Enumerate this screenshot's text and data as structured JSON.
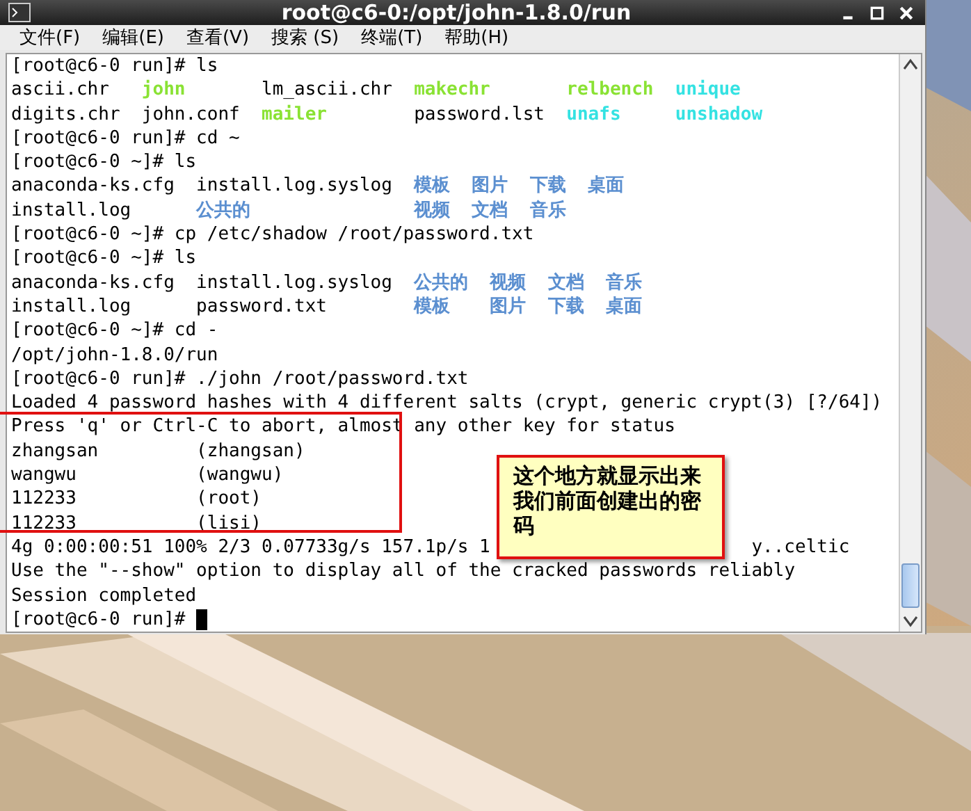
{
  "window": {
    "title": "root@c6-0:/opt/john-1.8.0/run"
  },
  "menu": [
    "文件(F)",
    "编辑(E)",
    "查看(V)",
    "搜索 (S)",
    "终端(T)",
    "帮助(H)"
  ],
  "terminal": {
    "lines": [
      {
        "kind": "text",
        "text": "[root@c6-0 run]# ls"
      },
      {
        "kind": "listing",
        "rows": [
          [
            {
              "text": "ascii.chr",
              "kind": "file",
              "color": "#000000"
            },
            {
              "text": "john",
              "kind": "exec",
              "color": "#8ae234"
            },
            {
              "text": "lm_ascii.chr",
              "kind": "file",
              "color": "#000000"
            },
            {
              "text": "makechr",
              "kind": "exec",
              "color": "#8ae234"
            },
            {
              "text": "relbench",
              "kind": "exec",
              "color": "#8ae234"
            },
            {
              "text": "unique",
              "kind": "link",
              "color": "#34e2e2"
            }
          ],
          [
            {
              "text": "digits.chr",
              "kind": "file",
              "color": "#000000"
            },
            {
              "text": "john.conf",
              "kind": "file",
              "color": "#000000"
            },
            {
              "text": "mailer",
              "kind": "exec",
              "color": "#8ae234"
            },
            {
              "text": "password.lst",
              "kind": "file",
              "color": "#000000"
            },
            {
              "text": "unafs",
              "kind": "link",
              "color": "#34e2e2"
            },
            {
              "text": "unshadow",
              "kind": "link",
              "color": "#34e2e2"
            }
          ]
        ]
      },
      {
        "kind": "text",
        "text": "[root@c6-0 run]# cd ~"
      },
      {
        "kind": "text",
        "text": "[root@c6-0 ~]# ls"
      },
      {
        "kind": "listing",
        "rows": [
          [
            {
              "text": "anaconda-ks.cfg",
              "kind": "file",
              "color": "#000000"
            },
            {
              "text": "install.log.syslog",
              "kind": "file",
              "color": "#000000"
            },
            {
              "text": "模板",
              "kind": "dir",
              "color": "#5b8fd0"
            },
            {
              "text": "图片",
              "kind": "dir",
              "color": "#5b8fd0"
            },
            {
              "text": "下载",
              "kind": "dir",
              "color": "#5b8fd0"
            },
            {
              "text": "桌面",
              "kind": "dir",
              "color": "#5b8fd0"
            }
          ],
          [
            {
              "text": "install.log",
              "kind": "file",
              "color": "#000000"
            },
            {
              "text": "公共的",
              "kind": "dir",
              "color": "#5b8fd0"
            },
            {
              "text": "视频",
              "kind": "dir",
              "color": "#5b8fd0"
            },
            {
              "text": "文档",
              "kind": "dir",
              "color": "#5b8fd0"
            },
            {
              "text": "音乐",
              "kind": "dir",
              "color": "#5b8fd0"
            }
          ]
        ]
      },
      {
        "kind": "text",
        "text": "[root@c6-0 ~]# cp /etc/shadow /root/password.txt"
      },
      {
        "kind": "text",
        "text": "[root@c6-0 ~]# ls"
      },
      {
        "kind": "listing",
        "rows": [
          [
            {
              "text": "anaconda-ks.cfg",
              "kind": "file",
              "color": "#000000"
            },
            {
              "text": "install.log.syslog",
              "kind": "file",
              "color": "#000000"
            },
            {
              "text": "公共的",
              "kind": "dir",
              "color": "#5b8fd0"
            },
            {
              "text": "视频",
              "kind": "dir",
              "color": "#5b8fd0"
            },
            {
              "text": "文档",
              "kind": "dir",
              "color": "#5b8fd0"
            },
            {
              "text": "音乐",
              "kind": "dir",
              "color": "#5b8fd0"
            }
          ],
          [
            {
              "text": "install.log",
              "kind": "file",
              "color": "#000000"
            },
            {
              "text": "password.txt",
              "kind": "file",
              "color": "#000000"
            },
            {
              "text": "模板",
              "kind": "dir",
              "color": "#5b8fd0"
            },
            {
              "text": "图片",
              "kind": "dir",
              "color": "#5b8fd0"
            },
            {
              "text": "下载",
              "kind": "dir",
              "color": "#5b8fd0"
            },
            {
              "text": "桌面",
              "kind": "dir",
              "color": "#5b8fd0"
            }
          ]
        ]
      },
      {
        "kind": "text",
        "text": "[root@c6-0 ~]# cd -"
      },
      {
        "kind": "text",
        "text": "/opt/john-1.8.0/run"
      },
      {
        "kind": "text",
        "text": "[root@c6-0 run]# ./john /root/password.txt"
      },
      {
        "kind": "text",
        "text": "Loaded 4 password hashes with 4 different salts (crypt, generic crypt(3) [?/64])"
      },
      {
        "kind": "text",
        "text": "Press 'q' or Ctrl-C to abort, almost any other key for status"
      },
      {
        "kind": "text",
        "text": "zhangsan         (zhangsan)"
      },
      {
        "kind": "text",
        "text": "wangwu           (wangwu)"
      },
      {
        "kind": "text",
        "text": "112233           (root)"
      },
      {
        "kind": "text",
        "text": "112233           (lisi)"
      },
      {
        "kind": "split",
        "parts": [
          "4g 0:00:00:51 100% 2/3 0.07733g/s 157.1p/s 1",
          "y..celtic"
        ]
      },
      {
        "kind": "text",
        "text": "Use the \"--show\" option to display all of the cracked passwords reliably"
      },
      {
        "kind": "text",
        "text": "Session completed"
      },
      {
        "kind": "prompt",
        "text": "[root@c6-0 run]#"
      }
    ]
  },
  "callout": {
    "text": "这个地方就显示出来我们前面创建出的密码"
  }
}
